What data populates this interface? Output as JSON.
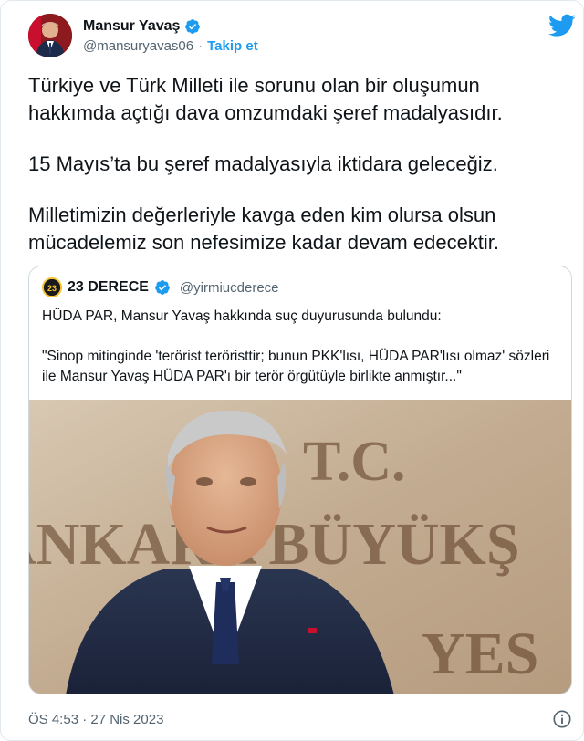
{
  "tweet": {
    "author": {
      "display_name": "Mansur Yavaş",
      "handle": "@mansuryavas06",
      "separator": "·",
      "follow_label": "Takip et",
      "verified": true,
      "avatar_icon": "profile-photo"
    },
    "paragraphs": [
      "Türkiye ve Türk Milleti ile sorunu olan bir oluşumun hakkımda açtığı dava omzumdaki şeref madalyasıdır.",
      "15 Mayıs’ta bu şeref madalyasıyla iktidara geleceğiz.",
      "Milletimizin değerleriyle kavga eden kim olursa olsun mücadelemiz son nefesimize kadar devam edecektir."
    ],
    "quote": {
      "display_name": "23 DERECE",
      "handle": "@yirmiucderece",
      "verified": true,
      "paragraphs": [
        "HÜDA PAR, Mansur Yavaş hakkında suç duyurusunda bulundu:",
        "\"Sinop mitinginde 'terörist teröristtir; bunun PKK'lısı, HÜDA PAR'lısı olmaz' sözleri ile Mansur Yavaş HÜDA PAR'ı bir terör örgütüyle birlikte anmıştır...\""
      ],
      "image_sign_line1": "T.C.",
      "image_sign_line2": "ANKARA BÜYÜKŞ",
      "image_sign_line3": "YES"
    },
    "timestamp": "ÖS 4:53 · 27 Nis 2023"
  },
  "colors": {
    "accent": "#1d9bf0",
    "text": "#0f1419",
    "secondary": "#536471",
    "border": "#cfd9de"
  },
  "icons": {
    "verified": "verified-badge-icon",
    "brand": "twitter-bird-icon",
    "info": "info-icon"
  }
}
